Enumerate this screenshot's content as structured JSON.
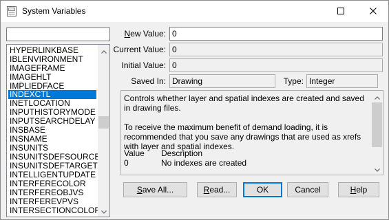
{
  "window": {
    "title": "System Variables"
  },
  "filter": {
    "value": ""
  },
  "variables": {
    "items": [
      "HYPERLINKBASE",
      "IBLENVIRONMENT",
      "IMAGEFRAME",
      "IMAGEHLT",
      "IMPLIEDFACE",
      "INDEXCTL",
      "INETLOCATION",
      "INPUTHISTORYMODE",
      "INPUTSEARCHDELAY",
      "INSBASE",
      "INSNAME",
      "INSUNITS",
      "INSUNITSDEFSOURCE",
      "INSUNITSDEFTARGET",
      "INTELLIGENTUPDATE",
      "INTERFERECOLOR",
      "INTERFEREOBJVS",
      "INTERFEREVPVS",
      "INTERSECTIONCOLOR"
    ],
    "selected": "INDEXCTL"
  },
  "fields": {
    "new_value": {
      "label": "New Value:",
      "label_accel": "N",
      "label_rest": "ew Value:",
      "value": "0"
    },
    "current_value": {
      "label": "Current Value:",
      "value": "0"
    },
    "initial_value": {
      "label": "Initial Value:",
      "value": "0"
    },
    "saved_in": {
      "label": "Saved In:",
      "value": "Drawing"
    },
    "type": {
      "label": "Type:",
      "value": "Integer"
    }
  },
  "description": {
    "para1": "Controls whether layer and spatial indexes are created and saved in drawing files.",
    "para2": "To receive the maximum benefit of demand loading, it is recommended that you save any drawings that are used as xrefs with layer and spatial indexes.",
    "col_value": "Value",
    "col_desc": "Description",
    "row_value": "0",
    "row_desc": "No indexes are created"
  },
  "buttons": {
    "save_all": {
      "accel": "S",
      "rest": "ave All..."
    },
    "read": {
      "accel": "R",
      "rest": "ead..."
    },
    "ok": {
      "label": "OK"
    },
    "cancel": {
      "label": "Cancel"
    },
    "help": {
      "accel": "H",
      "rest": "elp"
    }
  },
  "colors": {
    "selection": "#0078d7",
    "dialog_bg": "#f0f0f0",
    "button_bg": "#e1e1e1"
  },
  "icons": [
    "app-icon",
    "maximize-icon",
    "close-icon",
    "scroll-up-icon",
    "scroll-down-icon"
  ]
}
